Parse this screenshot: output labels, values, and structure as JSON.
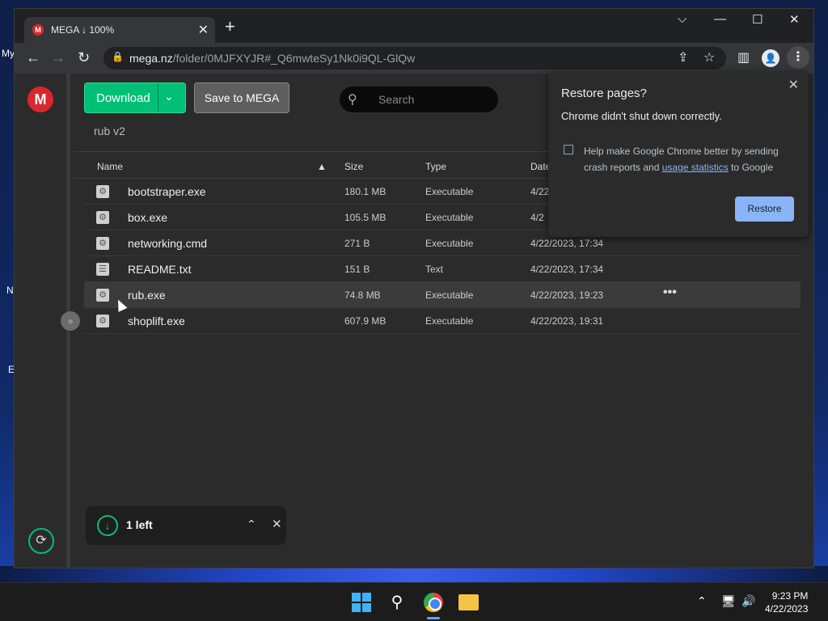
{
  "desktop": {
    "fragments": [
      "My",
      "N",
      "E"
    ]
  },
  "browser": {
    "tab": {
      "favicon_letter": "M",
      "title": "MEGA ↓ 100%",
      "close": "✕"
    },
    "new_tab": "+",
    "window_controls": {
      "dropdown": "⌵",
      "minimize": "—",
      "maximize": "☐",
      "close": "✕"
    },
    "nav": {
      "back": "←",
      "forward": "→",
      "reload": "↻"
    },
    "address": {
      "domain": "mega.nz",
      "path": "/folder/0MJFXYJR#_Q6mwteSy1Nk0i9QL-GlQw"
    },
    "profile_icon": "👤"
  },
  "mega": {
    "logo_letter": "M",
    "download_label": "Download",
    "save_label": "Save to MEGA",
    "search_placeholder": "Search",
    "folder_name": "rub v2",
    "columns": {
      "name": "Name",
      "size": "Size",
      "type": "Type",
      "date": "Date"
    },
    "files": [
      {
        "name": "bootstraper.exe",
        "size": "180.1 MB",
        "type": "Executable",
        "date": "4/22"
      },
      {
        "name": "box.exe",
        "size": "105.5 MB",
        "type": "Executable",
        "date": "4/2"
      },
      {
        "name": "networking.cmd",
        "size": "271 B",
        "type": "Executable",
        "date": "4/22/2023, 17:34"
      },
      {
        "name": "README.txt",
        "size": "151 B",
        "type": "Text",
        "date": "4/22/2023, 17:34"
      },
      {
        "name": "rub.exe",
        "size": "74.8 MB",
        "type": "Executable",
        "date": "4/22/2023, 19:23"
      },
      {
        "name": "shoplift.exe",
        "size": "607.9 MB",
        "type": "Executable",
        "date": "4/22/2023, 19:31"
      }
    ],
    "row_more": "•••",
    "download_widget": {
      "count": "1 left"
    }
  },
  "restore_popup": {
    "title": "Restore pages?",
    "message": "Chrome didn't shut down correctly.",
    "checkbox_text_before": "Help make Google Chrome better by sending crash reports and ",
    "checkbox_link": "usage statistics",
    "checkbox_text_after": " to Google",
    "restore_label": "Restore"
  },
  "taskbar": {
    "time": "9:23 PM",
    "date": "4/22/2023"
  },
  "colors": {
    "mega_red": "#d9272e",
    "mega_green": "#00c077",
    "chrome_blue": "#8ab4f8"
  }
}
